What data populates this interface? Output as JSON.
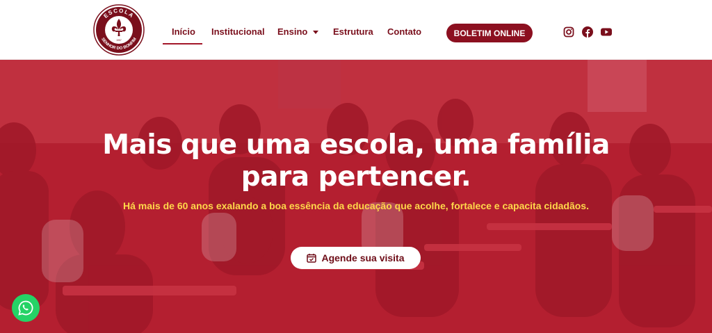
{
  "header": {
    "logo": {
      "top_text": "ESCOLA",
      "bottom_text": "SENHOR DO BONFIM",
      "year_text": "1957"
    },
    "nav": [
      {
        "label": "Início",
        "active": true
      },
      {
        "label": "Institucional"
      },
      {
        "label": "Ensino",
        "has_dropdown": true
      },
      {
        "label": "Estrutura"
      },
      {
        "label": "Contato"
      }
    ],
    "cta_label": "BOLETIM ONLINE",
    "social": [
      "instagram-icon",
      "facebook-icon",
      "youtube-icon"
    ]
  },
  "hero": {
    "title_line1": "Mais que uma escola, uma família",
    "title_line2": "para pertencer.",
    "subtitle": "Há mais de 60 anos exalando a boa essência da educação que acolhe, fortalece e capacita cidadãos.",
    "button_label": "Agende sua visita"
  },
  "colors": {
    "brand": "#8c1020",
    "hero_overlay": "#b21d2d",
    "subtitle": "#ffd84a",
    "whatsapp": "#25d366"
  }
}
